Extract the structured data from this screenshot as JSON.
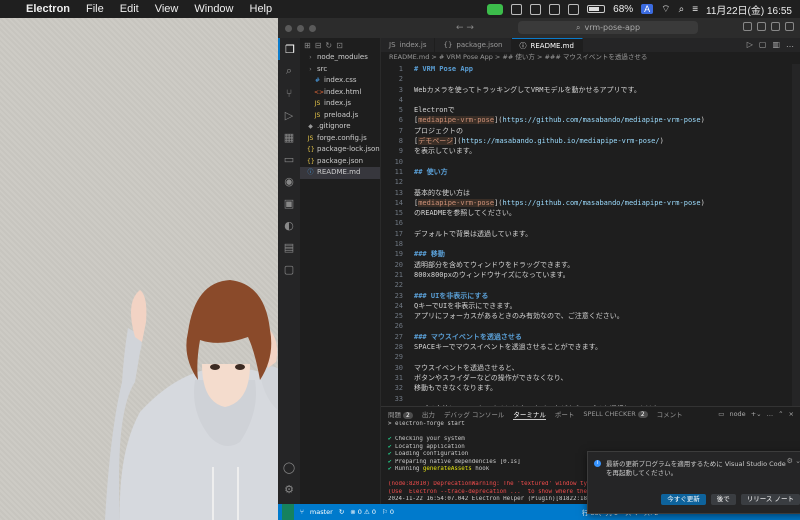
{
  "menubar": {
    "app": "Electron",
    "items": [
      "File",
      "Edit",
      "View",
      "Window",
      "Help"
    ],
    "battery": "68%",
    "clock": "11月22日(金)  16:55",
    "input_badge": "A"
  },
  "window": {
    "search": "vrm-pose-app"
  },
  "explorer": {
    "rows": [
      {
        "icon": "folder",
        "label": "node_modules",
        "indent": 1
      },
      {
        "icon": "folder",
        "label": "src",
        "indent": 1
      },
      {
        "icon": "css",
        "label": "index.css",
        "indent": 2
      },
      {
        "icon": "html",
        "label": "index.html",
        "indent": 2
      },
      {
        "icon": "js",
        "label": "index.js",
        "indent": 2
      },
      {
        "icon": "js",
        "label": "preload.js",
        "indent": 2
      },
      {
        "icon": "git",
        "label": ".gitignore",
        "indent": 1
      },
      {
        "icon": "js",
        "label": "forge.config.js",
        "indent": 1
      },
      {
        "icon": "json",
        "label": "package-lock.json",
        "indent": 1
      },
      {
        "icon": "json",
        "label": "package.json",
        "indent": 1
      },
      {
        "icon": "md",
        "label": "README.md",
        "indent": 1,
        "selected": true
      }
    ]
  },
  "tabs": [
    {
      "icon": "JS",
      "label": "index.js",
      "active": false
    },
    {
      "icon": "{}",
      "label": "package.json",
      "active": false
    },
    {
      "icon": "ⓘ",
      "label": "README.md",
      "active": true
    }
  ],
  "breadcrumb": "README.md > # VRM Pose App > ## 使い方 > ### マウスイベントを透過させる",
  "code": [
    {
      "n": 1,
      "html": "<span class='h'># VRM Pose App</span>"
    },
    {
      "n": 2,
      "html": ""
    },
    {
      "n": 3,
      "html": "Webカメラを使ってトラッキングしてVRMモデルを動かせるアプリです。"
    },
    {
      "n": 4,
      "html": ""
    },
    {
      "n": 5,
      "html": "Electronで"
    },
    {
      "n": 6,
      "html": "<span class='br'>[</span><span class='lk'>mediapipe-vrm-pose</span><span class='br'>](</span><span class='url'>https://github.com/masabando/mediapipe-vrm-pose</span><span class='br'>)</span>"
    },
    {
      "n": 7,
      "html": "プロジェクトの"
    },
    {
      "n": 8,
      "html": "<span class='br'>[</span><span class='lk'>デモページ</span><span class='br'>](</span><span class='url'>https://masabando.github.io/mediapipe-vrm-pose/</span><span class='br'>)</span>"
    },
    {
      "n": 9,
      "html": "を表示しています。"
    },
    {
      "n": 10,
      "html": ""
    },
    {
      "n": 11,
      "html": "<span class='h'>## 使い方</span>"
    },
    {
      "n": 12,
      "html": ""
    },
    {
      "n": 13,
      "html": "基本的な使い方は"
    },
    {
      "n": 14,
      "html": "<span class='br'>[</span><span class='lk'>mediapipe-vrm-pose</span><span class='br'>](</span><span class='url'>https://github.com/masabando/mediapipe-vrm-pose</span><span class='br'>)</span>"
    },
    {
      "n": 15,
      "html": "のREADMEを参照してください。"
    },
    {
      "n": 16,
      "html": ""
    },
    {
      "n": 17,
      "html": "デフォルトで背景は透過しています。"
    },
    {
      "n": 18,
      "html": ""
    },
    {
      "n": 19,
      "html": "<span class='h'>### 移動</span>"
    },
    {
      "n": 20,
      "html": "透明部分を含めてウィンドウをドラッグできます。"
    },
    {
      "n": 21,
      "html": "800x800pxのウィンドウサイズになっています。"
    },
    {
      "n": 22,
      "html": ""
    },
    {
      "n": 23,
      "html": "<span class='h'>### UIを非表示にする</span>"
    },
    {
      "n": 24,
      "html": "QキーでUIを非表示にできます。"
    },
    {
      "n": 25,
      "html": "アプリにフォーカスがあるときのみ有効なので、ご注意ください。"
    },
    {
      "n": 26,
      "html": ""
    },
    {
      "n": 27,
      "html": "<span class='h'>### マウスイベントを透過させる</span>"
    },
    {
      "n": 28,
      "html": "SPACEキーでマウスイベントを透過させることができます。"
    },
    {
      "n": 29,
      "html": ""
    },
    {
      "n": 30,
      "html": "マウスイベントを透過させると、"
    },
    {
      "n": 31,
      "html": "ボタンやスライダーなどの操作ができなくなり、"
    },
    {
      "n": 32,
      "html": "移動もできなくなります。"
    },
    {
      "n": 33,
      "html": ""
    },
    {
      "n": 34,
      "html": "アプリ自体にフォーカスするにはタスクバーなどからアプリを選択してください。"
    },
    {
      "n": 35,
      "html": ""
    }
  ],
  "panel": {
    "tabs": [
      {
        "label": "問題",
        "badge": "2"
      },
      {
        "label": "出力"
      },
      {
        "label": "デバッグ コンソール"
      },
      {
        "label": "ターミナル",
        "active": true
      },
      {
        "label": "ポート"
      },
      {
        "label": "SPELL CHECKER",
        "badge": "2"
      },
      {
        "label": "コメント"
      }
    ],
    "terminal_name": "node"
  },
  "terminal": [
    {
      "cls": "",
      "html": "&gt; electron-forge start"
    },
    {
      "cls": "",
      "html": ""
    },
    {
      "cls": "",
      "html": "<span class='ok'>✔</span> Checking your system"
    },
    {
      "cls": "",
      "html": "<span class='ok'>✔</span> Locating application"
    },
    {
      "cls": "",
      "html": "<span class='ok'>✔</span> Loading configuration"
    },
    {
      "cls": "",
      "html": "<span class='ok'>✔</span> Preparing native dependencies [0.1s]"
    },
    {
      "cls": "",
      "html": "<span class='ok'>✔</span> Running <span class='hl'>generateAssets</span> hook"
    },
    {
      "cls": "",
      "html": ""
    },
    {
      "cls": "err",
      "html": "(node:82010) DeprecationWarning: The 'textured' window type is deprec"
    },
    {
      "cls": "err",
      "html": "(Use `Electron --trace-deprecation ...` to show where the warning was"
    },
    {
      "cls": "",
      "html": "2024-11-22 16:54:07.042 Electron Helper (Plugin)[81822:18151122] WARN"
    },
    {
      "cls": "",
      "html": "ase use AVCaptureDeviceTypeContinuityCamera and add NSCameraUseContinu"
    },
    {
      "cls": "",
      "html": "▯"
    }
  ],
  "notification": {
    "message": "最新の更新プログラムを適用するために Visual Studio Code を再起動してください。",
    "buttons": [
      "今すぐ更新",
      "後で",
      "リリース ノート"
    ]
  },
  "statusbar": {
    "branch": "master",
    "problems": "⊗ 0 ⚠ 0",
    "ports": "⚐ 0",
    "position": "行 35、列 1",
    "spaces": "スペース: 2",
    "encoding": "UTF-8",
    "eol": "LF",
    "language": "{} Markdown",
    "golive": "Go Live"
  }
}
